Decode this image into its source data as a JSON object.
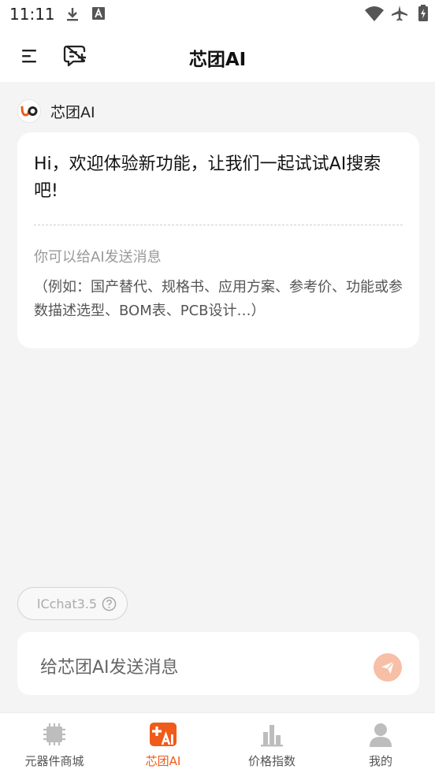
{
  "status_bar": {
    "time": "11:11"
  },
  "header": {
    "title": "芯团AI"
  },
  "bot": {
    "name": "芯团AI"
  },
  "message": {
    "greeting": "Hi，欢迎体验新功能，让我们一起试试AI搜索吧!",
    "hint_title": "你可以给AI发送消息",
    "hint_body": "（例如：国产替代、规格书、应用方案、参考价、功能或参数描述选型、BOM表、PCB设计…）"
  },
  "model_selector": {
    "label": "lCchat3.5"
  },
  "input": {
    "placeholder": "给芯团AI发送消息"
  },
  "tabs": [
    {
      "label": "元器件商城",
      "icon": "chip-icon",
      "active": false
    },
    {
      "label": "芯团AI",
      "icon": "ai-plus-icon",
      "active": true
    },
    {
      "label": "价格指数",
      "icon": "bar-chart-icon",
      "active": false
    },
    {
      "label": "我的",
      "icon": "user-icon",
      "active": false
    }
  ],
  "colors": {
    "accent": "#f05a1a",
    "send_button": "#f6bfa6",
    "background": "#f4f4f5"
  }
}
